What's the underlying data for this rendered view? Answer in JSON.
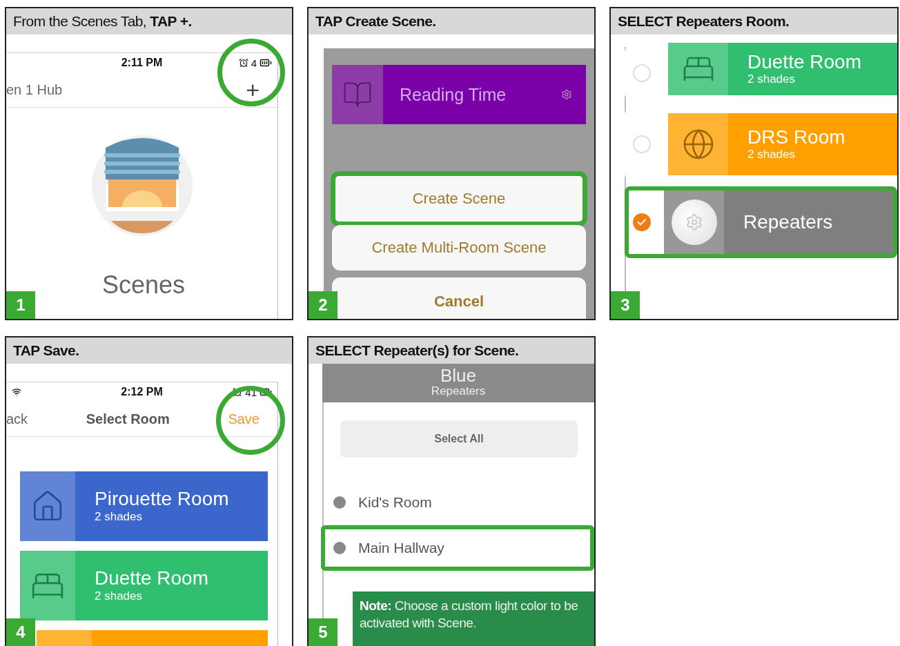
{
  "steps": [
    {
      "number": "1",
      "kind": "scenes",
      "instruction": "From the Scenes Tab, **TAP +.**",
      "bold": false,
      "screen": {
        "time": "2:11 PM",
        "battery": "4",
        "hub": "en 1 Hub",
        "add": "+",
        "add_highlighted": true,
        "title": "Scenes"
      }
    },
    {
      "number": "2",
      "kind": "action-sheet",
      "instruction": "TAP Create Scene.",
      "bold": true,
      "screen": {
        "scene": "Reading Time",
        "options": [
          {
            "label": "Create Scene",
            "highlighted": true
          },
          {
            "label": "Create Multi-Room Scene",
            "highlighted": false
          }
        ],
        "cancel": "Cancel"
      }
    },
    {
      "number": "3",
      "kind": "room-select",
      "instruction": "SELECT Repeaters Room.",
      "bold": true,
      "screen": {
        "rooms": [
          {
            "kind": "bed",
            "name": "Duette Room",
            "subtitle": "2 shades",
            "color": "#2fbf6f",
            "selected": false,
            "highlighted": false
          },
          {
            "kind": "globe",
            "name": "DRS Room",
            "subtitle": "2 shades",
            "color": "#ffa000",
            "selected": false,
            "highlighted": false
          },
          {
            "kind": "repeater",
            "name": "Repeaters",
            "color": "#7f7f7f",
            "selected": true,
            "highlighted": true
          }
        ]
      }
    },
    {
      "number": "4",
      "kind": "save",
      "instruction": "TAP Save.",
      "bold": true,
      "screen": {
        "time": "2:12 PM",
        "battery": "41",
        "back": "ack",
        "title": "Select Room",
        "save": "Save",
        "save_highlighted": true,
        "rooms": [
          {
            "kind": "house",
            "name": "Pirouette Room",
            "subtitle": "2 shades",
            "color": "#3b66cc"
          },
          {
            "kind": "bed",
            "name": "Duette Room",
            "subtitle": "2 shades",
            "color": "#2fbf6f"
          },
          {
            "kind": "blank",
            "color": "#ffa000"
          }
        ]
      }
    },
    {
      "number": "5",
      "kind": "repeater-select",
      "instruction": "SELECT Repeater(s) for Scene.",
      "bold": true,
      "screen": {
        "color_name": "Blue",
        "group": "Repeaters",
        "select_all": "Select All",
        "repeaters": [
          {
            "name": "Kid's Room",
            "highlighted": false
          },
          {
            "name": "Main Hallway",
            "highlighted": true
          }
        ],
        "note": "**Note:**  Choose a custom light color to be activated with Scene."
      }
    }
  ]
}
